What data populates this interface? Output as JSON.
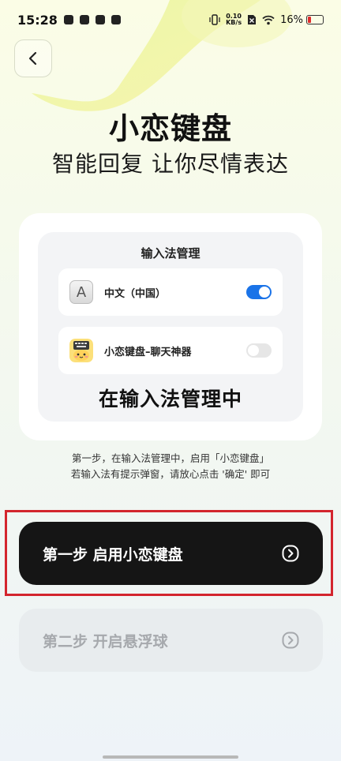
{
  "status_bar": {
    "time": "15:28",
    "net_speed_value": "0.10",
    "net_speed_unit": "KB/s",
    "battery_text": "16%"
  },
  "header": {
    "title": "小恋键盘",
    "subtitle": "智能回复 让你尽情表达"
  },
  "card": {
    "title": "输入法管理",
    "items": [
      {
        "label": "中文（中国）",
        "icon": "letter-a-keyboard-icon",
        "enabled": true
      },
      {
        "label": "小恋键盘–聊天神器",
        "icon": "xiaolian-keyboard-app-icon",
        "enabled": false
      }
    ],
    "caption": "在输入法管理中"
  },
  "instructions": {
    "line1": "第一步，在输入法管理中，启用「小恋键盘」",
    "line2": "若输入法有提示弹窗，请放心点击 '确定' 即可"
  },
  "steps": [
    {
      "label": "第一步 启用小恋键盘",
      "active": true
    },
    {
      "label": "第二步 开启悬浮球",
      "active": false
    }
  ],
  "colors": {
    "accent_blue": "#1a73e8",
    "highlight_red": "#d3252e",
    "primary_button": "#151515",
    "disabled_button": "#e8ecee"
  }
}
